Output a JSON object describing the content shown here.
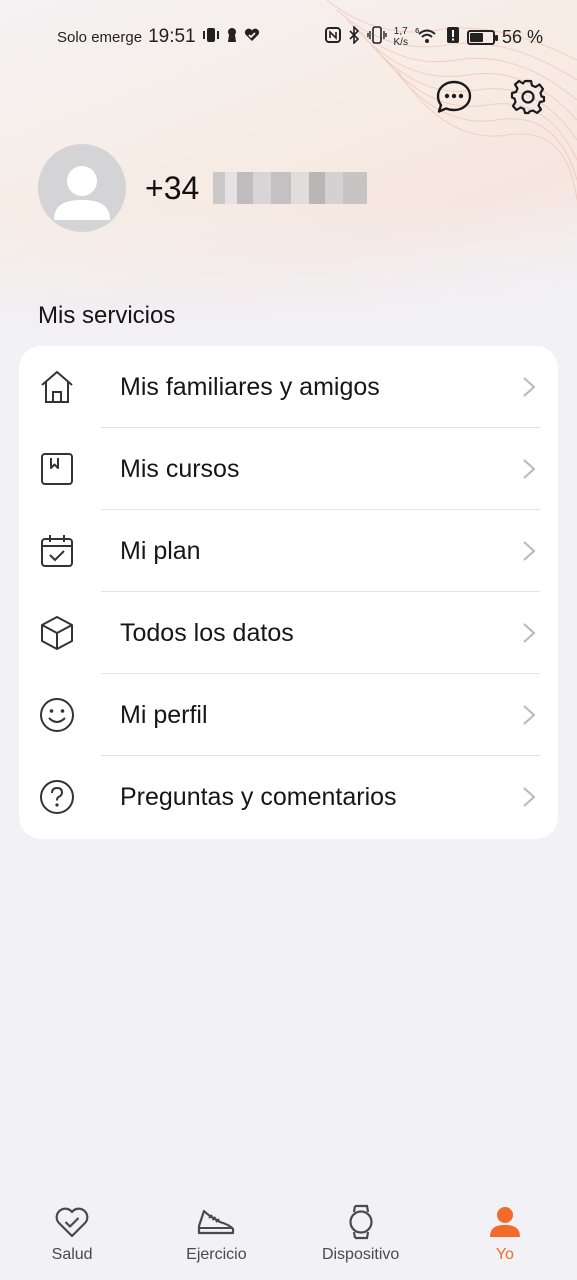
{
  "status_bar": {
    "carrier": "Solo emerge",
    "time": "19:51",
    "speed_value": "1,7",
    "speed_unit": "K/s",
    "battery": "56 %"
  },
  "header": {
    "messages_icon": "chat-bubble-icon",
    "settings_icon": "gear-icon"
  },
  "profile": {
    "phone_prefix": "+34"
  },
  "services": {
    "title": "Mis servicios",
    "items": [
      {
        "label": "Mis familiares y amigos",
        "icon": "home-icon"
      },
      {
        "label": "Mis cursos",
        "icon": "bookmark-icon"
      },
      {
        "label": "Mi plan",
        "icon": "calendar-check-icon"
      },
      {
        "label": "Todos los datos",
        "icon": "cube-icon"
      },
      {
        "label": "Mi perfil",
        "icon": "smiley-icon"
      },
      {
        "label": "Preguntas y comentarios",
        "icon": "question-icon"
      }
    ]
  },
  "bottom_nav": {
    "items": [
      {
        "label": "Salud",
        "icon": "heart-check-icon"
      },
      {
        "label": "Ejercicio",
        "icon": "shoe-icon"
      },
      {
        "label": "Dispositivo",
        "icon": "watch-icon"
      },
      {
        "label": "Yo",
        "icon": "person-icon",
        "active": true
      }
    ]
  },
  "colors": {
    "accent": "#f26b2a",
    "background": "#f1f1f6",
    "card": "#ffffff"
  }
}
